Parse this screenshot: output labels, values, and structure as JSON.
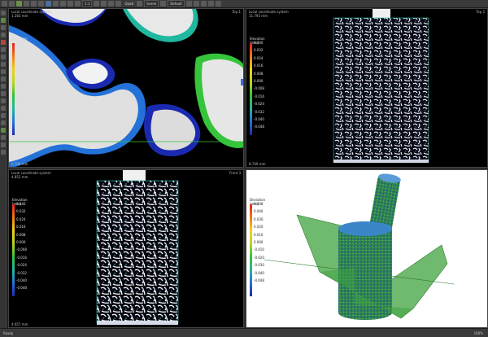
{
  "toolbar": {
    "mode_label": "Quad",
    "view_label": "Scene",
    "snapshot_label": "Default",
    "zoom_label": "1:1"
  },
  "viewports": [
    {
      "header": [
        "Local coordinate system",
        "1.283 mm"
      ],
      "corner": "Top 1",
      "legend_title": "Elevation [mm]",
      "footer": "0.709 mm"
    },
    {
      "header": [
        "Local coordinate system",
        "11.795 mm"
      ],
      "corner": "Top 2",
      "legend_title": "Elevation [mm]",
      "footer": "8.749 mm"
    },
    {
      "header": [
        "Local coordinate system",
        "4.852 mm"
      ],
      "corner": "Front 3",
      "legend_title": "Elevation [mm]",
      "footer": "4.657 mm"
    },
    {
      "header": [],
      "corner": "",
      "legend_title": "Deviation [mm]",
      "footer": ""
    }
  ],
  "legend_ticks": [
    "0.040",
    "0.032",
    "0.024",
    "0.016",
    "0.008",
    "0.000",
    "-0.008",
    "-0.016",
    "-0.024",
    "-0.032",
    "-0.040",
    "-0.048"
  ],
  "legend_ticks_dev": [
    "0.048",
    "0.040",
    "0.030",
    "0.020",
    "0.010",
    "0.000",
    "-0.010",
    "-0.020",
    "-0.030",
    "-0.040",
    "-0.048"
  ],
  "status": {
    "left": "Ready",
    "right": "100%"
  }
}
